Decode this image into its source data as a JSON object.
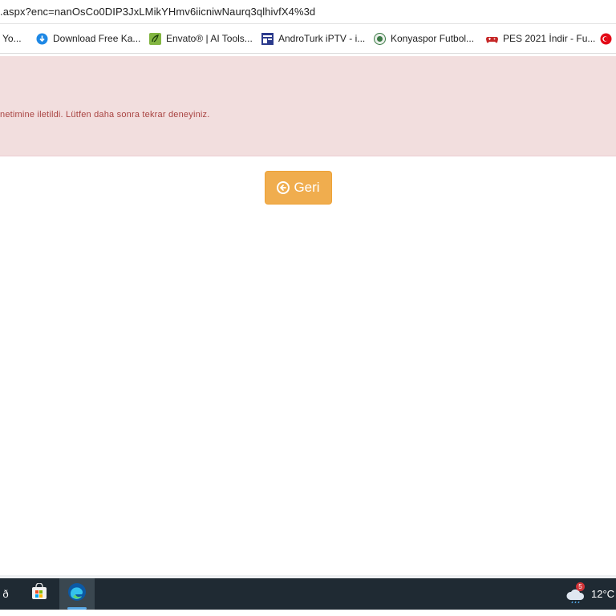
{
  "browser": {
    "address": ".aspx?enc=nanOsCo0DIP3JxLMikYHmv6iicniwNaurq3qlhivfX4%3d",
    "bookmarks": [
      {
        "label": "Yo...",
        "icon": "youtube-icon"
      },
      {
        "label": "Download Free Ka...",
        "icon": "download-icon"
      },
      {
        "label": "Envato® | AI Tools...",
        "icon": "envato-leaf-icon"
      },
      {
        "label": "AndroTurk iPTV - i...",
        "icon": "androturk-icon"
      },
      {
        "label": "Konyaspor Futbol...",
        "icon": "konyaspor-crest-icon"
      },
      {
        "label": "PES 2021 İndir - Fu...",
        "icon": "gamepad-icon"
      },
      {
        "label": "",
        "icon": "flag-icon"
      }
    ]
  },
  "page": {
    "alert_text": "netimine iletildi. Lütfen daha sonra tekrar deneyiniz.",
    "back_button_label": "Geri",
    "colors": {
      "alert_bg": "#f2dede",
      "alert_text": "#a94442",
      "button_bg": "#f0ad4e"
    }
  },
  "taskbar": {
    "left_glyph": "ð",
    "apps": [
      {
        "name": "Microsoft Store",
        "icon": "store-icon"
      },
      {
        "name": "Microsoft Edge",
        "icon": "edge-icon",
        "active": true
      }
    ],
    "weather": {
      "badge": "5",
      "temperature": "12°C",
      "icon": "weather-cloud-icon"
    }
  }
}
